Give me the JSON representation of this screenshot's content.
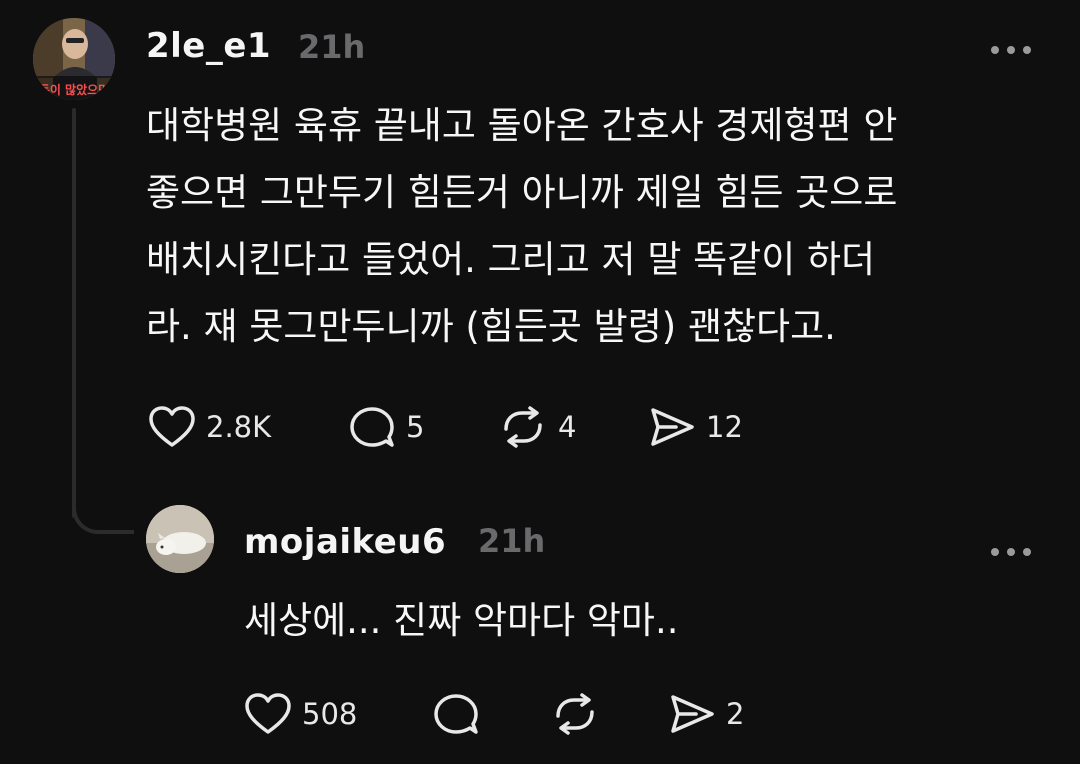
{
  "post": {
    "username": "2le_e1",
    "time": "21h",
    "more": "···",
    "lines": [
      "대학병원 육휴 끝내고 돌아온 간호사 경제형편 안",
      "좋으면 그만두기 힘든거 아니까 제일 힘든 곳으로",
      "배치시킨다고 들었어. 그리고 저 말 똑같이 하더",
      "라. 쟤 못그만두니까 (힘든곳 발령) 괜찮다고."
    ],
    "avatar_caption": "돈이 많았으면",
    "actions": {
      "like_icon": "heart-icon",
      "like_count": "2.8K",
      "comment_icon": "comment-bubble-icon",
      "comment_count": "5",
      "repost_icon": "repost-icon",
      "repost_count": "4",
      "share_icon": "send-icon",
      "share_count": "12"
    }
  },
  "reply": {
    "username": "mojaikeu6",
    "time": "21h",
    "more": "···",
    "text": "세상에... 진짜 악마다 악마..",
    "actions": {
      "like_icon": "heart-icon",
      "like_count": "508",
      "comment_icon": "comment-bubble-icon",
      "comment_count": "",
      "repost_icon": "repost-icon",
      "repost_count": "",
      "share_icon": "send-icon",
      "share_count": "2"
    }
  },
  "colors": {
    "background": "#0f0f10",
    "text": "#f3f3f3",
    "muted": "#6a6a6c",
    "thread_line": "#2b2b2d"
  }
}
